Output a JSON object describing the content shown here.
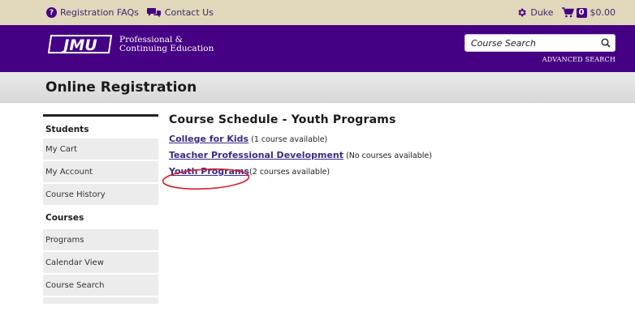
{
  "topbar": {
    "faq_label": "Registration FAQs",
    "contact_label": "Contact Us",
    "user_label": "Duke",
    "cart_count": "0",
    "cart_total": "$0.00"
  },
  "header": {
    "logo_mark": "JMU",
    "logo_line1": "Professional &",
    "logo_line2": "Continuing Education",
    "search_placeholder": "Course Search",
    "advanced_search_label": "ADVANCED SEARCH"
  },
  "page": {
    "title": "Online Registration"
  },
  "sidebar": {
    "students_heading": "Students",
    "students_items": [
      {
        "label": "My Cart"
      },
      {
        "label": "My Account"
      },
      {
        "label": "Course History"
      }
    ],
    "courses_heading": "Courses",
    "courses_items": [
      {
        "label": "Programs"
      },
      {
        "label": "Calendar View"
      },
      {
        "label": "Course Search"
      }
    ]
  },
  "main": {
    "heading": "Course Schedule - Youth Programs",
    "categories": [
      {
        "name": "College for Kids",
        "count": "(1 course available)"
      },
      {
        "name": "Teacher Professional Development",
        "count": "(No courses available)"
      },
      {
        "name": "Youth Programs",
        "count": "(2 courses available)"
      }
    ]
  },
  "colors": {
    "brand_purple": "#450084",
    "topbar_gold": "#e1d8bc",
    "link_purple": "#3b2a85",
    "annotation_red": "#d0202a"
  }
}
